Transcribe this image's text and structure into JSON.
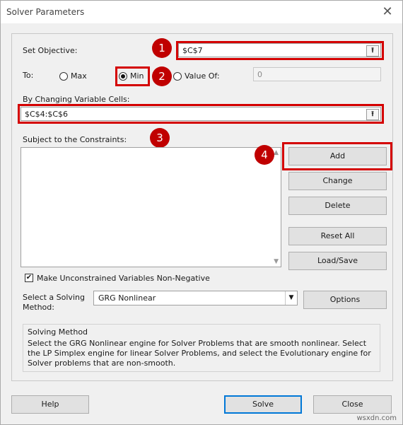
{
  "window": {
    "title": "Solver Parameters",
    "close_glyph": "✕"
  },
  "objective": {
    "label": "Set Objective:",
    "value": "$C$7"
  },
  "to": {
    "label": "To:",
    "options": [
      {
        "label": "Max",
        "selected": false
      },
      {
        "label": "Min",
        "selected": true
      },
      {
        "label": "Value Of:",
        "selected": false
      }
    ],
    "value_of": "0"
  },
  "changing": {
    "label": "By Changing Variable Cells:",
    "value": "$C$4:$C$6"
  },
  "constraints": {
    "label": "Subject to the Constraints:",
    "items": []
  },
  "buttons": {
    "add": "Add",
    "change": "Change",
    "delete": "Delete",
    "reset_all": "Reset All",
    "load_save": "Load/Save",
    "options": "Options",
    "help": "Help",
    "solve": "Solve",
    "close": "Close"
  },
  "nonneg": {
    "label": "Make Unconstrained Variables Non-Negative",
    "checked": true
  },
  "method": {
    "label_line1": "Select a Solving",
    "label_line2": "Method:",
    "selected": "GRG Nonlinear"
  },
  "info": {
    "title": "Solving Method",
    "text": "Select the GRG Nonlinear engine for Solver Problems that are smooth nonlinear. Select the LP Simplex engine for linear Solver Problems, and select the Evolutionary engine for Solver problems that are non-smooth."
  },
  "annotations": {
    "b1": "1",
    "b2": "2",
    "b3": "3",
    "b4": "4",
    "color": "#c00000"
  },
  "icons": {
    "ref_button": "collapse-dialog-icon",
    "ref_glyph": "⭱",
    "checkmark": "✔"
  },
  "watermark": "wsxdn.com"
}
